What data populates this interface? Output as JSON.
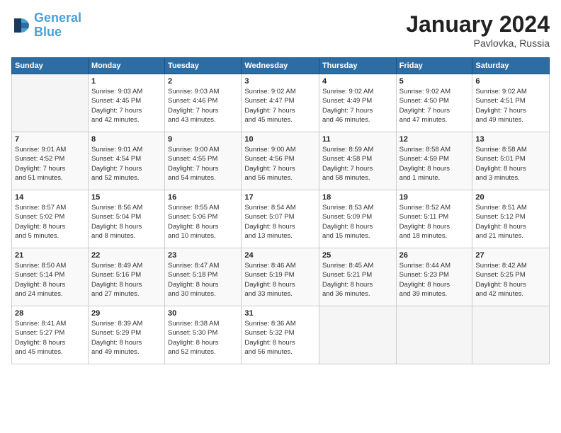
{
  "logo": {
    "text_general": "General",
    "text_blue": "Blue"
  },
  "title": "January 2024",
  "location": "Pavlovka, Russia",
  "days_header": [
    "Sunday",
    "Monday",
    "Tuesday",
    "Wednesday",
    "Thursday",
    "Friday",
    "Saturday"
  ],
  "weeks": [
    [
      {
        "day": "",
        "info": ""
      },
      {
        "day": "1",
        "info": "Sunrise: 9:03 AM\nSunset: 4:45 PM\nDaylight: 7 hours\nand 42 minutes."
      },
      {
        "day": "2",
        "info": "Sunrise: 9:03 AM\nSunset: 4:46 PM\nDaylight: 7 hours\nand 43 minutes."
      },
      {
        "day": "3",
        "info": "Sunrise: 9:02 AM\nSunset: 4:47 PM\nDaylight: 7 hours\nand 45 minutes."
      },
      {
        "day": "4",
        "info": "Sunrise: 9:02 AM\nSunset: 4:49 PM\nDaylight: 7 hours\nand 46 minutes."
      },
      {
        "day": "5",
        "info": "Sunrise: 9:02 AM\nSunset: 4:50 PM\nDaylight: 7 hours\nand 47 minutes."
      },
      {
        "day": "6",
        "info": "Sunrise: 9:02 AM\nSunset: 4:51 PM\nDaylight: 7 hours\nand 49 minutes."
      }
    ],
    [
      {
        "day": "7",
        "info": "Sunrise: 9:01 AM\nSunset: 4:52 PM\nDaylight: 7 hours\nand 51 minutes."
      },
      {
        "day": "8",
        "info": "Sunrise: 9:01 AM\nSunset: 4:54 PM\nDaylight: 7 hours\nand 52 minutes."
      },
      {
        "day": "9",
        "info": "Sunrise: 9:00 AM\nSunset: 4:55 PM\nDaylight: 7 hours\nand 54 minutes."
      },
      {
        "day": "10",
        "info": "Sunrise: 9:00 AM\nSunset: 4:56 PM\nDaylight: 7 hours\nand 56 minutes."
      },
      {
        "day": "11",
        "info": "Sunrise: 8:59 AM\nSunset: 4:58 PM\nDaylight: 7 hours\nand 58 minutes."
      },
      {
        "day": "12",
        "info": "Sunrise: 8:58 AM\nSunset: 4:59 PM\nDaylight: 8 hours\nand 1 minute."
      },
      {
        "day": "13",
        "info": "Sunrise: 8:58 AM\nSunset: 5:01 PM\nDaylight: 8 hours\nand 3 minutes."
      }
    ],
    [
      {
        "day": "14",
        "info": "Sunrise: 8:57 AM\nSunset: 5:02 PM\nDaylight: 8 hours\nand 5 minutes."
      },
      {
        "day": "15",
        "info": "Sunrise: 8:56 AM\nSunset: 5:04 PM\nDaylight: 8 hours\nand 8 minutes."
      },
      {
        "day": "16",
        "info": "Sunrise: 8:55 AM\nSunset: 5:06 PM\nDaylight: 8 hours\nand 10 minutes."
      },
      {
        "day": "17",
        "info": "Sunrise: 8:54 AM\nSunset: 5:07 PM\nDaylight: 8 hours\nand 13 minutes."
      },
      {
        "day": "18",
        "info": "Sunrise: 8:53 AM\nSunset: 5:09 PM\nDaylight: 8 hours\nand 15 minutes."
      },
      {
        "day": "19",
        "info": "Sunrise: 8:52 AM\nSunset: 5:11 PM\nDaylight: 8 hours\nand 18 minutes."
      },
      {
        "day": "20",
        "info": "Sunrise: 8:51 AM\nSunset: 5:12 PM\nDaylight: 8 hours\nand 21 minutes."
      }
    ],
    [
      {
        "day": "21",
        "info": "Sunrise: 8:50 AM\nSunset: 5:14 PM\nDaylight: 8 hours\nand 24 minutes."
      },
      {
        "day": "22",
        "info": "Sunrise: 8:49 AM\nSunset: 5:16 PM\nDaylight: 8 hours\nand 27 minutes."
      },
      {
        "day": "23",
        "info": "Sunrise: 8:47 AM\nSunset: 5:18 PM\nDaylight: 8 hours\nand 30 minutes."
      },
      {
        "day": "24",
        "info": "Sunrise: 8:46 AM\nSunset: 5:19 PM\nDaylight: 8 hours\nand 33 minutes."
      },
      {
        "day": "25",
        "info": "Sunrise: 8:45 AM\nSunset: 5:21 PM\nDaylight: 8 hours\nand 36 minutes."
      },
      {
        "day": "26",
        "info": "Sunrise: 8:44 AM\nSunset: 5:23 PM\nDaylight: 8 hours\nand 39 minutes."
      },
      {
        "day": "27",
        "info": "Sunrise: 8:42 AM\nSunset: 5:25 PM\nDaylight: 8 hours\nand 42 minutes."
      }
    ],
    [
      {
        "day": "28",
        "info": "Sunrise: 8:41 AM\nSunset: 5:27 PM\nDaylight: 8 hours\nand 45 minutes."
      },
      {
        "day": "29",
        "info": "Sunrise: 8:39 AM\nSunset: 5:29 PM\nDaylight: 8 hours\nand 49 minutes."
      },
      {
        "day": "30",
        "info": "Sunrise: 8:38 AM\nSunset: 5:30 PM\nDaylight: 8 hours\nand 52 minutes."
      },
      {
        "day": "31",
        "info": "Sunrise: 8:36 AM\nSunset: 5:32 PM\nDaylight: 8 hours\nand 56 minutes."
      },
      {
        "day": "",
        "info": ""
      },
      {
        "day": "",
        "info": ""
      },
      {
        "day": "",
        "info": ""
      }
    ]
  ]
}
